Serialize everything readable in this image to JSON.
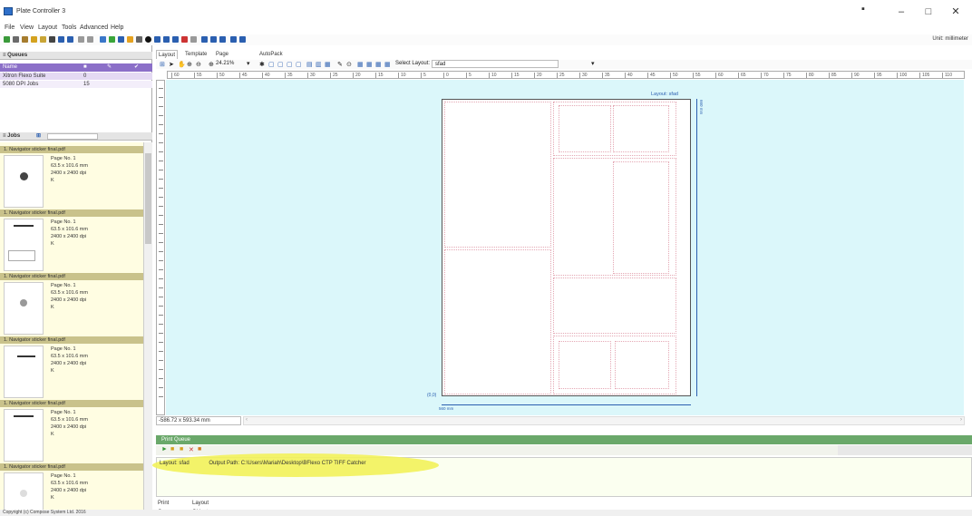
{
  "window": {
    "title": "Plate Controller 3"
  },
  "menu": [
    "File",
    "View",
    "Layout",
    "Tools",
    "Advanced",
    "Help"
  ],
  "toolbar": {
    "unit_label": "Unit: millimeter"
  },
  "queues": {
    "header": "Queues",
    "column_name": "Name",
    "rows": [
      {
        "name": "Xitron Flexo Suite",
        "count": "0"
      },
      {
        "name": "5080 DPI Jobs",
        "count": "15"
      }
    ]
  },
  "jobs": {
    "header": "Jobs",
    "items": [
      {
        "title": "1. Navigator sticker final.pdf",
        "page": "Page No. 1",
        "size": "63.5 x 101.6 mm",
        "dpi": "2400 x 2400 dpi",
        "k": "K"
      },
      {
        "title": "1. Navigator sticker final.pdf",
        "page": "Page No. 1",
        "size": "63.5 x 101.6 mm",
        "dpi": "2400 x 2400 dpi",
        "k": "K"
      },
      {
        "title": "1. Navigator sticker final.pdf",
        "page": "Page No. 1",
        "size": "63.5 x 101.6 mm",
        "dpi": "2400 x 2400 dpi",
        "k": "K"
      },
      {
        "title": "1. Navigator sticker final.pdf",
        "page": "Page No. 1",
        "size": "63.5 x 101.6 mm",
        "dpi": "2400 x 2400 dpi",
        "k": "K"
      },
      {
        "title": "1. Navigator sticker final.pdf",
        "page": "Page No. 1",
        "size": "63.5 x 101.6 mm",
        "dpi": "2400 x 2400 dpi",
        "k": "K"
      },
      {
        "title": "1. Navigator sticker final.pdf",
        "page": "Page No. 1",
        "size": "63.5 x 101.6 mm",
        "dpi": "2400 x 2400 dpi",
        "k": "K"
      }
    ]
  },
  "tabs": [
    "Layout",
    "Template",
    "Page Preview",
    "AutoPack"
  ],
  "canvas_toolbar": {
    "zoom": "24.21%",
    "select_layout_label": "Select Layout:",
    "select_layout_value": "sfad"
  },
  "ruler_h_ticks": [
    "60",
    "55",
    "50",
    "45",
    "40",
    "35",
    "30",
    "25",
    "20",
    "15",
    "10",
    "5",
    "0",
    "5",
    "10",
    "15",
    "20",
    "25",
    "30",
    "35",
    "40",
    "45",
    "50",
    "55",
    "60",
    "65",
    "70",
    "75",
    "80",
    "85",
    "90",
    "95",
    "100",
    "105",
    "110"
  ],
  "layout": {
    "name_label": "Layout: sfad",
    "origin": "(0,0)",
    "width_label": "560 mm",
    "height_label": "660 mm"
  },
  "status": {
    "coords": "-586.72 x 593.34 mm"
  },
  "print_queue": {
    "header": "Print Queue",
    "row": {
      "layout": "Layout: sfad",
      "output_path": "Output Path: C:\\Users\\Mariah\\Desktop\\BFlexo CTP TIFF Catcher"
    }
  },
  "bottom_tabs": [
    "Print Queue",
    "Layout Objects"
  ],
  "statusbar": {
    "copyright": "Copyright (c) Compose System Ltd. 2016"
  },
  "colors": {
    "canvas_bg": "#dbf7fa",
    "queue_header": "#8b6fc8",
    "job_header": "#c9c28b",
    "print_queue_bar": "#6aa86a",
    "highlight": "#f2f25a"
  }
}
